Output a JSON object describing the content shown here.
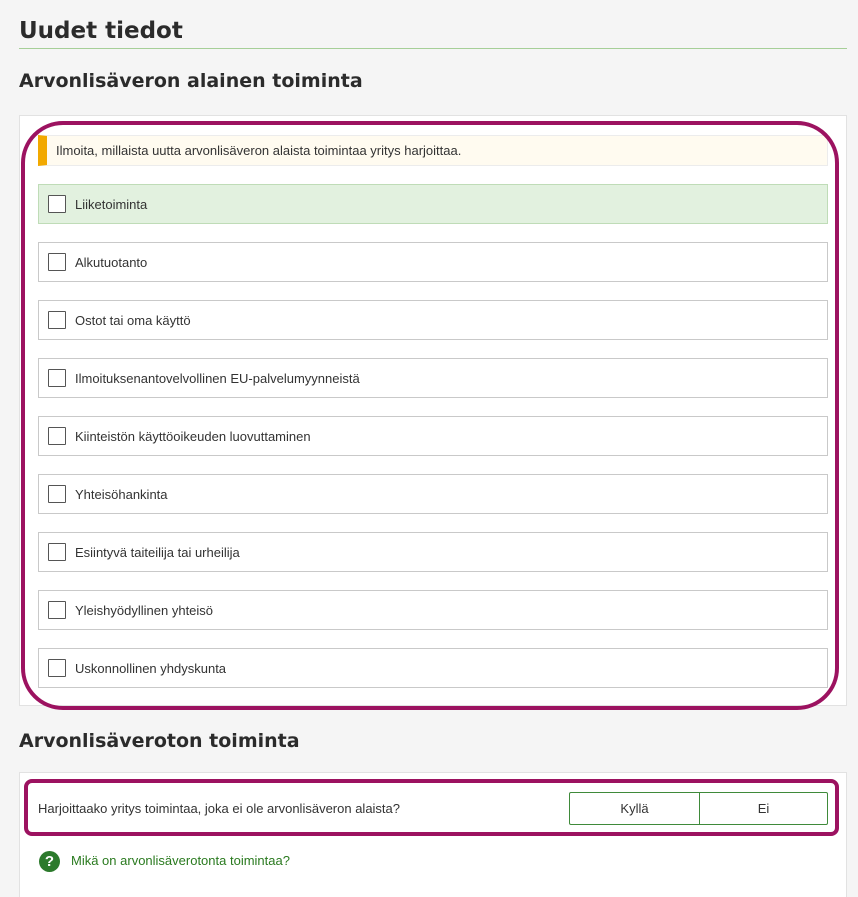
{
  "page": {
    "title": "Uudet tiedot"
  },
  "vat_section": {
    "heading": "Arvonlisäveron alainen toiminta",
    "notice": "Ilmoita, millaista uutta arvonlisäveron alaista toimintaa yritys harjoittaa.",
    "options": [
      {
        "label": "Liiketoiminta",
        "checked": false,
        "highlighted": true
      },
      {
        "label": "Alkutuotanto",
        "checked": false
      },
      {
        "label": "Ostot tai oma käyttö",
        "checked": false
      },
      {
        "label": "Ilmoituksenantovelvollinen EU-palvelumyynneistä",
        "checked": false
      },
      {
        "label": "Kiinteistön käyttöoikeuden luovuttaminen",
        "checked": false
      },
      {
        "label": "Yhteisöhankinta",
        "checked": false
      },
      {
        "label": "Esiintyvä taiteilija tai urheilija",
        "checked": false
      },
      {
        "label": "Yleishyödyllinen yhteisö",
        "checked": false
      },
      {
        "label": "Uskonnollinen yhdyskunta",
        "checked": false
      }
    ]
  },
  "exempt_section": {
    "heading": "Arvonlisäveroton toiminta",
    "question": "Harjoittaako yritys toimintaa, joka ei ole arvonlisäveron alaista?",
    "yes_label": "Kyllä",
    "no_label": "Ei",
    "help_link": "Mikä on arvonlisäverotonta toimintaa?",
    "help_icon": "?"
  },
  "colors": {
    "accent_green": "#2c7a2c",
    "highlight_frame": "#9c1260",
    "notice_bar": "#f2a900",
    "selected_row": "#e2f1df"
  }
}
